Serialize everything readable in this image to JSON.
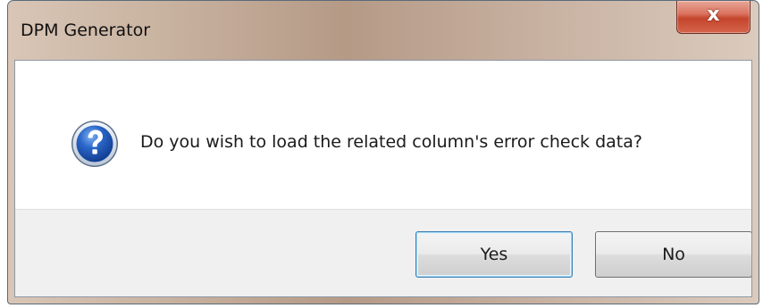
{
  "window": {
    "title": "DPM Generator",
    "close_glyph": "x"
  },
  "dialog": {
    "icon": "question-icon",
    "message": "Do you wish to load the related column's error check data?"
  },
  "buttons": {
    "yes_label": "Yes",
    "no_label": "No"
  },
  "colors": {
    "question_icon_blue": "#1c56b8",
    "close_button_red": "#c4452c",
    "default_button_border": "#3c7fb1"
  }
}
